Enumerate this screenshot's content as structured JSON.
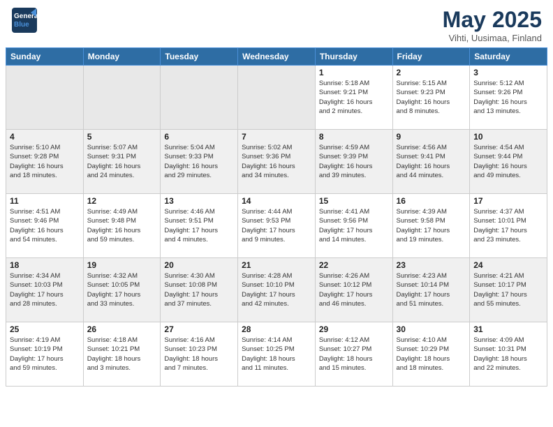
{
  "header": {
    "logo_general": "General",
    "logo_blue": "Blue",
    "month_title": "May 2025",
    "location": "Vihti, Uusimaa, Finland"
  },
  "weekdays": [
    "Sunday",
    "Monday",
    "Tuesday",
    "Wednesday",
    "Thursday",
    "Friday",
    "Saturday"
  ],
  "weeks": [
    [
      {
        "day": "",
        "info": ""
      },
      {
        "day": "",
        "info": ""
      },
      {
        "day": "",
        "info": ""
      },
      {
        "day": "",
        "info": ""
      },
      {
        "day": "1",
        "info": "Sunrise: 5:18 AM\nSunset: 9:21 PM\nDaylight: 16 hours\nand 2 minutes."
      },
      {
        "day": "2",
        "info": "Sunrise: 5:15 AM\nSunset: 9:23 PM\nDaylight: 16 hours\nand 8 minutes."
      },
      {
        "day": "3",
        "info": "Sunrise: 5:12 AM\nSunset: 9:26 PM\nDaylight: 16 hours\nand 13 minutes."
      }
    ],
    [
      {
        "day": "4",
        "info": "Sunrise: 5:10 AM\nSunset: 9:28 PM\nDaylight: 16 hours\nand 18 minutes."
      },
      {
        "day": "5",
        "info": "Sunrise: 5:07 AM\nSunset: 9:31 PM\nDaylight: 16 hours\nand 24 minutes."
      },
      {
        "day": "6",
        "info": "Sunrise: 5:04 AM\nSunset: 9:33 PM\nDaylight: 16 hours\nand 29 minutes."
      },
      {
        "day": "7",
        "info": "Sunrise: 5:02 AM\nSunset: 9:36 PM\nDaylight: 16 hours\nand 34 minutes."
      },
      {
        "day": "8",
        "info": "Sunrise: 4:59 AM\nSunset: 9:39 PM\nDaylight: 16 hours\nand 39 minutes."
      },
      {
        "day": "9",
        "info": "Sunrise: 4:56 AM\nSunset: 9:41 PM\nDaylight: 16 hours\nand 44 minutes."
      },
      {
        "day": "10",
        "info": "Sunrise: 4:54 AM\nSunset: 9:44 PM\nDaylight: 16 hours\nand 49 minutes."
      }
    ],
    [
      {
        "day": "11",
        "info": "Sunrise: 4:51 AM\nSunset: 9:46 PM\nDaylight: 16 hours\nand 54 minutes."
      },
      {
        "day": "12",
        "info": "Sunrise: 4:49 AM\nSunset: 9:48 PM\nDaylight: 16 hours\nand 59 minutes."
      },
      {
        "day": "13",
        "info": "Sunrise: 4:46 AM\nSunset: 9:51 PM\nDaylight: 17 hours\nand 4 minutes."
      },
      {
        "day": "14",
        "info": "Sunrise: 4:44 AM\nSunset: 9:53 PM\nDaylight: 17 hours\nand 9 minutes."
      },
      {
        "day": "15",
        "info": "Sunrise: 4:41 AM\nSunset: 9:56 PM\nDaylight: 17 hours\nand 14 minutes."
      },
      {
        "day": "16",
        "info": "Sunrise: 4:39 AM\nSunset: 9:58 PM\nDaylight: 17 hours\nand 19 minutes."
      },
      {
        "day": "17",
        "info": "Sunrise: 4:37 AM\nSunset: 10:01 PM\nDaylight: 17 hours\nand 23 minutes."
      }
    ],
    [
      {
        "day": "18",
        "info": "Sunrise: 4:34 AM\nSunset: 10:03 PM\nDaylight: 17 hours\nand 28 minutes."
      },
      {
        "day": "19",
        "info": "Sunrise: 4:32 AM\nSunset: 10:05 PM\nDaylight: 17 hours\nand 33 minutes."
      },
      {
        "day": "20",
        "info": "Sunrise: 4:30 AM\nSunset: 10:08 PM\nDaylight: 17 hours\nand 37 minutes."
      },
      {
        "day": "21",
        "info": "Sunrise: 4:28 AM\nSunset: 10:10 PM\nDaylight: 17 hours\nand 42 minutes."
      },
      {
        "day": "22",
        "info": "Sunrise: 4:26 AM\nSunset: 10:12 PM\nDaylight: 17 hours\nand 46 minutes."
      },
      {
        "day": "23",
        "info": "Sunrise: 4:23 AM\nSunset: 10:14 PM\nDaylight: 17 hours\nand 51 minutes."
      },
      {
        "day": "24",
        "info": "Sunrise: 4:21 AM\nSunset: 10:17 PM\nDaylight: 17 hours\nand 55 minutes."
      }
    ],
    [
      {
        "day": "25",
        "info": "Sunrise: 4:19 AM\nSunset: 10:19 PM\nDaylight: 17 hours\nand 59 minutes."
      },
      {
        "day": "26",
        "info": "Sunrise: 4:18 AM\nSunset: 10:21 PM\nDaylight: 18 hours\nand 3 minutes."
      },
      {
        "day": "27",
        "info": "Sunrise: 4:16 AM\nSunset: 10:23 PM\nDaylight: 18 hours\nand 7 minutes."
      },
      {
        "day": "28",
        "info": "Sunrise: 4:14 AM\nSunset: 10:25 PM\nDaylight: 18 hours\nand 11 minutes."
      },
      {
        "day": "29",
        "info": "Sunrise: 4:12 AM\nSunset: 10:27 PM\nDaylight: 18 hours\nand 15 minutes."
      },
      {
        "day": "30",
        "info": "Sunrise: 4:10 AM\nSunset: 10:29 PM\nDaylight: 18 hours\nand 18 minutes."
      },
      {
        "day": "31",
        "info": "Sunrise: 4:09 AM\nSunset: 10:31 PM\nDaylight: 18 hours\nand 22 minutes."
      }
    ]
  ]
}
